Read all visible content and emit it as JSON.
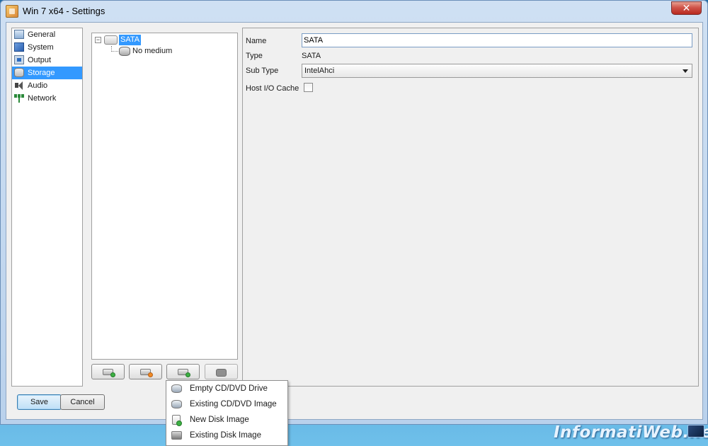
{
  "window": {
    "title": "Win 7 x64 - Settings",
    "close_label": "✕"
  },
  "sidebar": {
    "items": [
      {
        "label": "General",
        "icon": "general-icon",
        "selected": false
      },
      {
        "label": "System",
        "icon": "system-icon",
        "selected": false
      },
      {
        "label": "Output",
        "icon": "output-icon",
        "selected": false
      },
      {
        "label": "Storage",
        "icon": "storage-icon",
        "selected": true
      },
      {
        "label": "Audio",
        "icon": "audio-icon",
        "selected": false
      },
      {
        "label": "Network",
        "icon": "network-icon",
        "selected": false
      }
    ]
  },
  "tree": {
    "controller_label": "SATA",
    "device_label": "No medium",
    "expander": "−",
    "toolbar": [
      {
        "name": "add-controller-button",
        "icon": "add-icon",
        "enabled": true
      },
      {
        "name": "remove-controller-button",
        "icon": "remove-icon",
        "enabled": true
      },
      {
        "name": "add-device-button",
        "icon": "add-device-icon",
        "enabled": true
      },
      {
        "name": "remove-device-button",
        "icon": "device-icon",
        "enabled": false
      }
    ]
  },
  "details": {
    "name_label": "Name",
    "name_value": "SATA",
    "type_label": "Type",
    "type_value": "SATA",
    "subtype_label": "Sub Type",
    "subtype_value": "IntelAhci",
    "hostio_label": "Host I/O Cache",
    "hostio_checked": false
  },
  "buttons": {
    "save": "Save",
    "cancel": "Cancel"
  },
  "popup_menu": {
    "items": [
      {
        "label": "Empty CD/DVD Drive",
        "icon": "cd-drive-icon"
      },
      {
        "label": "Existing CD/DVD Image",
        "icon": "cd-image-icon"
      },
      {
        "label": "New Disk Image",
        "icon": "new-disk-image-icon"
      },
      {
        "label": "Existing Disk Image",
        "icon": "hard-disk-icon"
      }
    ]
  },
  "watermark": "InformatiWeb.net",
  "colors": {
    "selection": "#3399ff",
    "accent_green": "#3cb043",
    "accent_orange": "#f08a24"
  }
}
